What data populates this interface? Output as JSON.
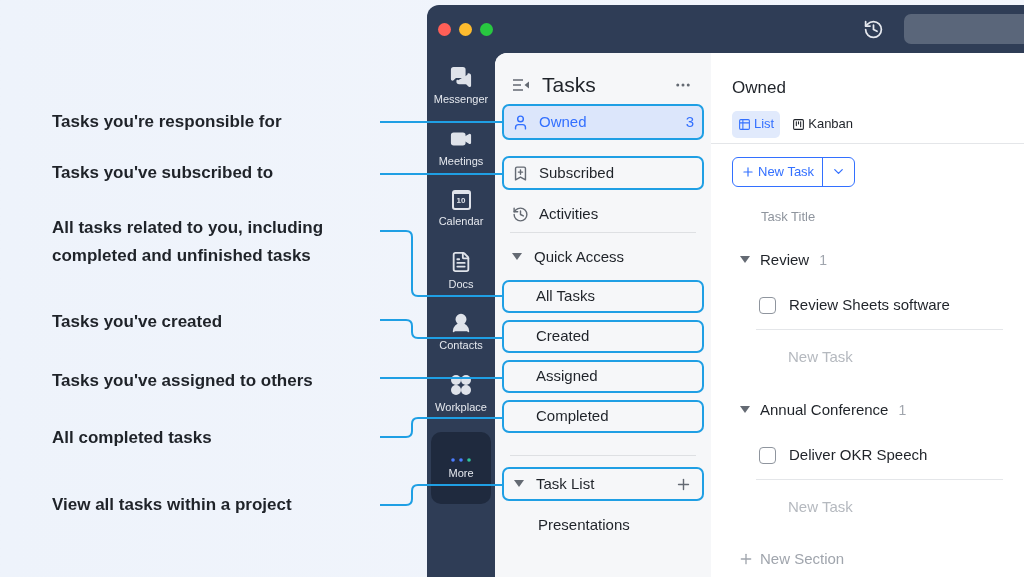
{
  "callouts": [
    {
      "text": "Tasks you're responsible for"
    },
    {
      "text": "Tasks you've subscribed to"
    },
    {
      "text": "All tasks related to you, including completed and unfinished tasks"
    },
    {
      "text": "Tasks you've created"
    },
    {
      "text": "Tasks you've assigned to others"
    },
    {
      "text": "All completed tasks"
    },
    {
      "text": "View all tasks within a project"
    }
  ],
  "rail": [
    {
      "label": "Messenger",
      "kind": "messenger",
      "selected": false
    },
    {
      "label": "Meetings",
      "kind": "meetings",
      "selected": false
    },
    {
      "label": "Calendar",
      "kind": "calendar",
      "icon_text": "10",
      "selected": false
    },
    {
      "label": "Docs",
      "kind": "docs",
      "selected": false
    },
    {
      "label": "Contacts",
      "kind": "contacts",
      "selected": false
    },
    {
      "label": "Workplace",
      "kind": "workplace",
      "selected": false
    },
    {
      "label": "More",
      "kind": "more",
      "selected": true
    }
  ],
  "sidebar": {
    "title": "Tasks",
    "items": [
      {
        "label": "Owned",
        "kind": "owned",
        "count": "3",
        "selected": true,
        "highlighted": true
      },
      {
        "label": "Subscribed",
        "kind": "subscribed",
        "selected": false,
        "highlighted": true
      },
      {
        "label": "Activities",
        "kind": "activities",
        "selected": false,
        "highlighted": false
      }
    ],
    "quick_access": {
      "label": "Quick Access",
      "expanded": true,
      "items": [
        {
          "label": "All Tasks",
          "selected": false,
          "highlighted": true
        },
        {
          "label": "Created",
          "selected": false,
          "highlighted": true
        },
        {
          "label": "Assigned",
          "selected": false,
          "highlighted": true
        },
        {
          "label": "Completed",
          "selected": false,
          "highlighted": true
        }
      ]
    },
    "task_list": {
      "label": "Task List",
      "expanded": true,
      "highlighted": true,
      "items": [
        {
          "label": "Presentations",
          "selected": false
        }
      ]
    }
  },
  "main": {
    "title": "Owned",
    "tabs": [
      {
        "label": "List",
        "kind": "list",
        "selected": true
      },
      {
        "label": "Kanban",
        "kind": "kanban",
        "selected": false
      }
    ],
    "new_task_button": "New Task",
    "column": "Task Title",
    "sections": [
      {
        "name": "Review",
        "count": "1",
        "expanded": true,
        "tasks": [
          {
            "title": "Review Sheets software",
            "checked": false
          }
        ],
        "new_task": "New Task"
      },
      {
        "name": "Annual Conference",
        "count": "1",
        "expanded": true,
        "tasks": [
          {
            "title": "Deliver OKR Speech",
            "checked": false
          }
        ],
        "new_task": "New Task"
      }
    ],
    "new_section": "New Section"
  }
}
